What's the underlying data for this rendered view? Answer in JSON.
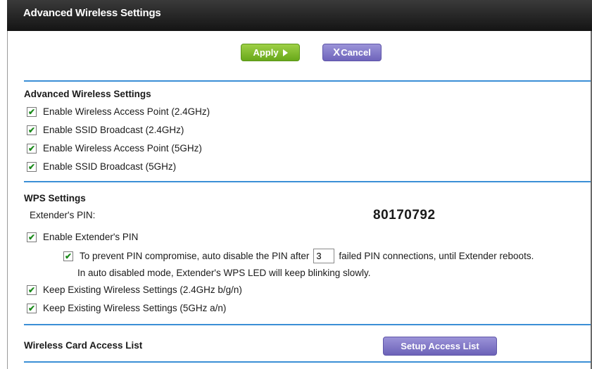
{
  "header": {
    "title": "Advanced Wireless Settings"
  },
  "toolbar": {
    "apply_label": "Apply",
    "cancel_label": "Cancel"
  },
  "advanced": {
    "title": "Advanced Wireless Settings",
    "items": [
      {
        "label": "Enable Wireless Access Point (2.4GHz)",
        "checked": true
      },
      {
        "label": "Enable SSID Broadcast (2.4GHz)",
        "checked": true
      },
      {
        "label": "Enable Wireless Access Point (5GHz)",
        "checked": true
      },
      {
        "label": "Enable SSID Broadcast (5GHz)",
        "checked": true
      }
    ]
  },
  "wps": {
    "title": "WPS Settings",
    "pin_label": "Extender's PIN:",
    "pin_value": "80170792",
    "enable_pin_label": "Enable Extender's PIN",
    "prevent_label_before": "To prevent PIN compromise, auto disable the PIN after",
    "prevent_value": "3",
    "prevent_label_after": "failed PIN connections, until Extender reboots.",
    "auto_disabled_note": "In auto disabled mode, Extender's WPS LED will keep blinking slowly.",
    "keep_24_label": "Keep Existing Wireless Settings (2.4GHz b/g/n)",
    "keep_5_label": "Keep Existing Wireless Settings (5GHz a/n)"
  },
  "access_list": {
    "title": "Wireless Card Access List",
    "button_label": "Setup Access List"
  },
  "colors": {
    "accent_line": "#3b8fd6",
    "apply_green": "#7fbf2e",
    "cancel_purple": "#7b72c6"
  }
}
